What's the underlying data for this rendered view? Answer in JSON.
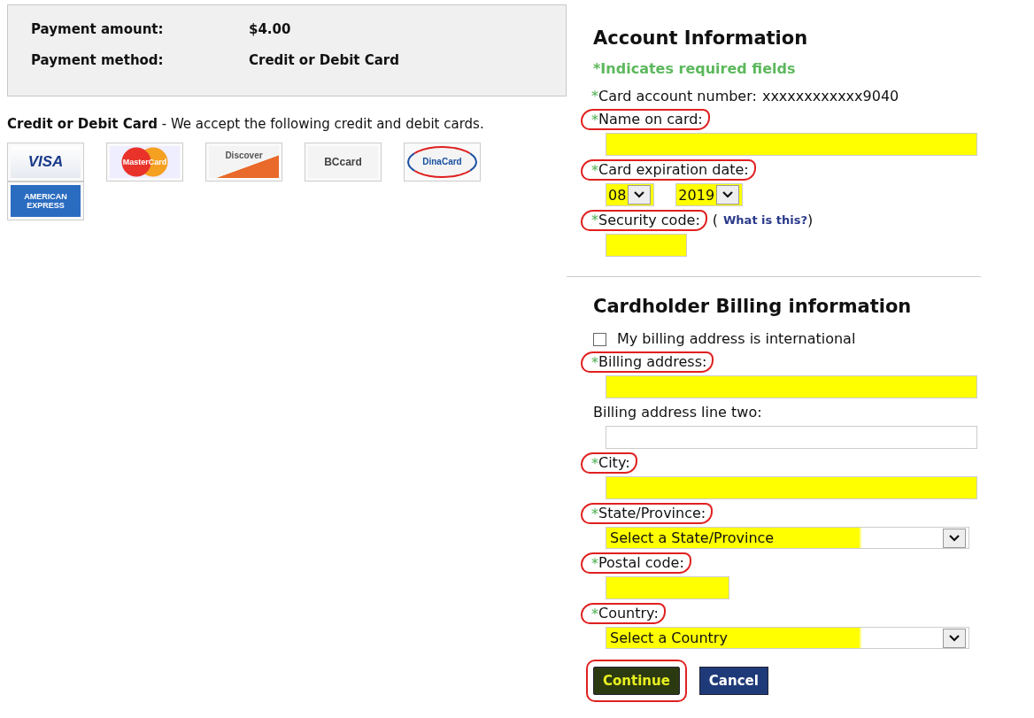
{
  "payment_summary": [
    {
      "label": "Payment amount:",
      "value": "$4.00"
    },
    {
      "label": "Payment method:",
      "value": "Credit or Debit Card"
    }
  ],
  "intro": "**Credit or Debit Card** - We accept the following credit and debit cards.",
  "cards": [
    {
      "kind": "visa",
      "label": "VISA"
    },
    {
      "kind": "mastercard",
      "label": "MasterCard"
    },
    {
      "kind": "discover",
      "label": "Discover"
    },
    {
      "kind": "bccard",
      "label": "BCcard"
    },
    {
      "kind": "dinacard",
      "label": "DinaCard"
    },
    {
      "kind": "amex",
      "label": "AMERICAN EXPRESS"
    }
  ],
  "required_mark": "*",
  "account": {
    "title": "Account Information",
    "required_note": "*Indicates required fields",
    "card_number": {
      "label": "Card account number:",
      "value": "xxxxxxxxxxxx9040",
      "required": true
    },
    "fields": [
      {
        "kind": "text",
        "label": "Name on card:",
        "required": true,
        "circled": true,
        "highlighted": true
      },
      {
        "kind": "expiry",
        "label": "Card expiration date:",
        "required": true,
        "circled": true,
        "highlighted": true,
        "month": "08",
        "year": "2019"
      },
      {
        "kind": "security",
        "label": "Security code:",
        "required": true,
        "circled": true,
        "highlighted": true,
        "paren_open": "(",
        "link": "What is this?",
        "paren_close": ")"
      }
    ]
  },
  "billing": {
    "title": "Cardholder Billing information",
    "international": {
      "label": "My billing address is international",
      "checked": false
    },
    "fields": [
      {
        "kind": "text",
        "label": "Billing address:",
        "required": true,
        "circled": true,
        "highlighted": true
      },
      {
        "kind": "text",
        "label": "Billing address line two:",
        "required": false,
        "circled": false,
        "highlighted": false
      },
      {
        "kind": "text",
        "label": "City:",
        "required": true,
        "circled": true,
        "highlighted": true
      },
      {
        "kind": "select",
        "label": "State/Province:",
        "required": true,
        "circled": true,
        "highlighted": true,
        "value": "Select a State/Province"
      },
      {
        "kind": "short",
        "label": "Postal code:",
        "required": true,
        "circled": true,
        "highlighted": true
      },
      {
        "kind": "select",
        "label": "Country:",
        "required": true,
        "circled": true,
        "highlighted": true,
        "value": "Select a Country"
      }
    ]
  },
  "buttons": [
    {
      "label": "Continue",
      "circled": true,
      "highlighted": true
    },
    {
      "label": "Cancel",
      "circled": false,
      "highlighted": false
    }
  ]
}
